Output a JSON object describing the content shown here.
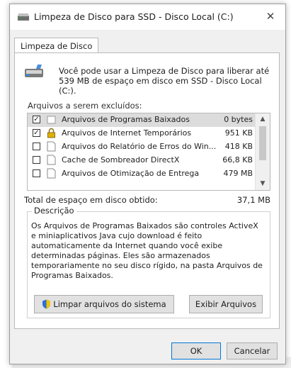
{
  "window": {
    "title": "Limpeza de Disco para SSD - Disco Local (C:)",
    "close_symbol": "✕"
  },
  "tab": {
    "label": "Limpeza de Disco"
  },
  "intro": {
    "text": "Você pode usar a Limpeza de Disco para liberar até 539 MB de espaço em disco em SSD - Disco Local (C:)."
  },
  "files": {
    "label": "Arquivos a serem excluídos:",
    "items": [
      {
        "name": "Arquivos de Programas Baixados",
        "size": "0 bytes",
        "checked": true,
        "icon": "folder-icon"
      },
      {
        "name": "Arquivos de Internet Temporários",
        "size": "951 KB",
        "checked": true,
        "icon": "lock-icon"
      },
      {
        "name": "Arquivos do Relatório de Erros do Win...",
        "size": "418 KB",
        "checked": false,
        "icon": "document-icon"
      },
      {
        "name": "Cache de Sombreador DirectX",
        "size": "66,8 KB",
        "checked": false,
        "icon": "document-icon"
      },
      {
        "name": "Arquivos de Otimização de Entrega",
        "size": "479 MB",
        "checked": false,
        "icon": "document-icon"
      }
    ]
  },
  "total": {
    "label": "Total de espaço em disco obtido:",
    "value": "37,1 MB"
  },
  "description": {
    "title": "Descrição",
    "text": "Os Arquivos de Programas Baixados são controles ActiveX e miniaplicativos Java cujo download é feito automaticamente da Internet quando você exibe determinadas páginas. Eles são armazenados temporariamente no seu disco rígido, na pasta Arquivos de Programas Baixados."
  },
  "buttons": {
    "clean_system": "Limpar arquivos do sistema",
    "view_files": "Exibir Arquivos",
    "ok": "OK",
    "cancel": "Cancelar"
  },
  "scrollbar": {
    "up": "▲",
    "down": "▼"
  },
  "colors": {
    "accent": "#0078d7",
    "window_bg": "#f0f0f0",
    "selection": "#dcdcdc"
  }
}
